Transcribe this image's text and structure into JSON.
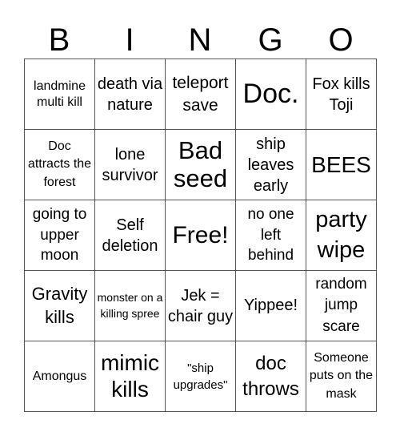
{
  "header": [
    "B",
    "I",
    "N",
    "G",
    "O"
  ],
  "cells": [
    "landmine multi kill",
    "death via nature",
    "teleport save",
    "Doc.",
    "Fox kills Toji",
    "Doc attracts the forest",
    "lone survivor",
    "Bad seed",
    "ship leaves early",
    "BEES",
    "going to upper moon",
    "Self deletion",
    "Free!",
    "no one left behind",
    "party wipe",
    "Gravity kills",
    "monster on a killing spree",
    "Jek = chair guy",
    "Yippee!",
    "random jump scare",
    "Amongus",
    "mimic kills",
    "\"ship upgrades\"",
    "doc throws",
    "Someone puts on the mask"
  ]
}
